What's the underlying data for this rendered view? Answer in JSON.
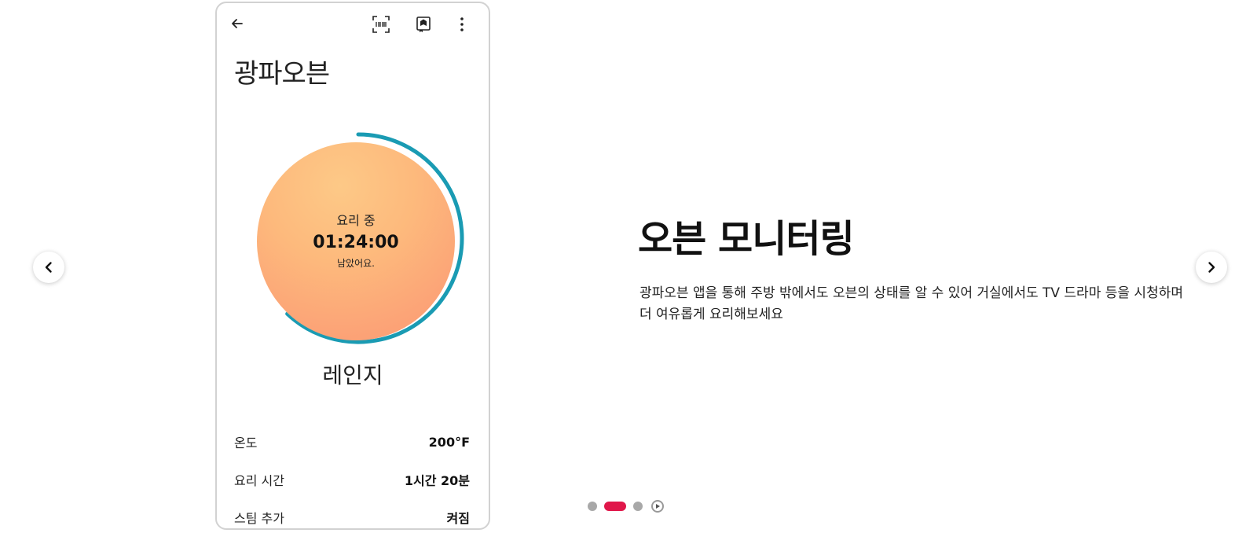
{
  "phone": {
    "title": "광파오븐",
    "dial": {
      "status": "요리 중",
      "time": "01:24:00",
      "sub": "남았어요.",
      "progress": 0.62,
      "ring_color": "#1a9bb3"
    },
    "mode": "레인지",
    "settings": [
      {
        "label": "온도",
        "value": "200°F"
      },
      {
        "label": "요리 시간",
        "value": "1시간 20분"
      },
      {
        "label": "스팀 추가",
        "value": "켜짐"
      }
    ]
  },
  "feature": {
    "title": "오븐 모니터링",
    "description": "광파오븐 앱을 통해 주방 밖에서도 오븐의 상태를 알 수 있어 거실에서도 TV 드라마 등을 시청하며 더 여유롭게 요리해보세요"
  },
  "pagination": {
    "total": 3,
    "active_index": 1,
    "active_color": "#e0174a"
  },
  "icons": {
    "back": "arrow-left-icon",
    "scan": "scan-icon",
    "manual": "book-icon",
    "more": "more-vertical-icon",
    "prev": "chevron-left-icon",
    "next": "chevron-right-icon",
    "play": "play-icon"
  }
}
